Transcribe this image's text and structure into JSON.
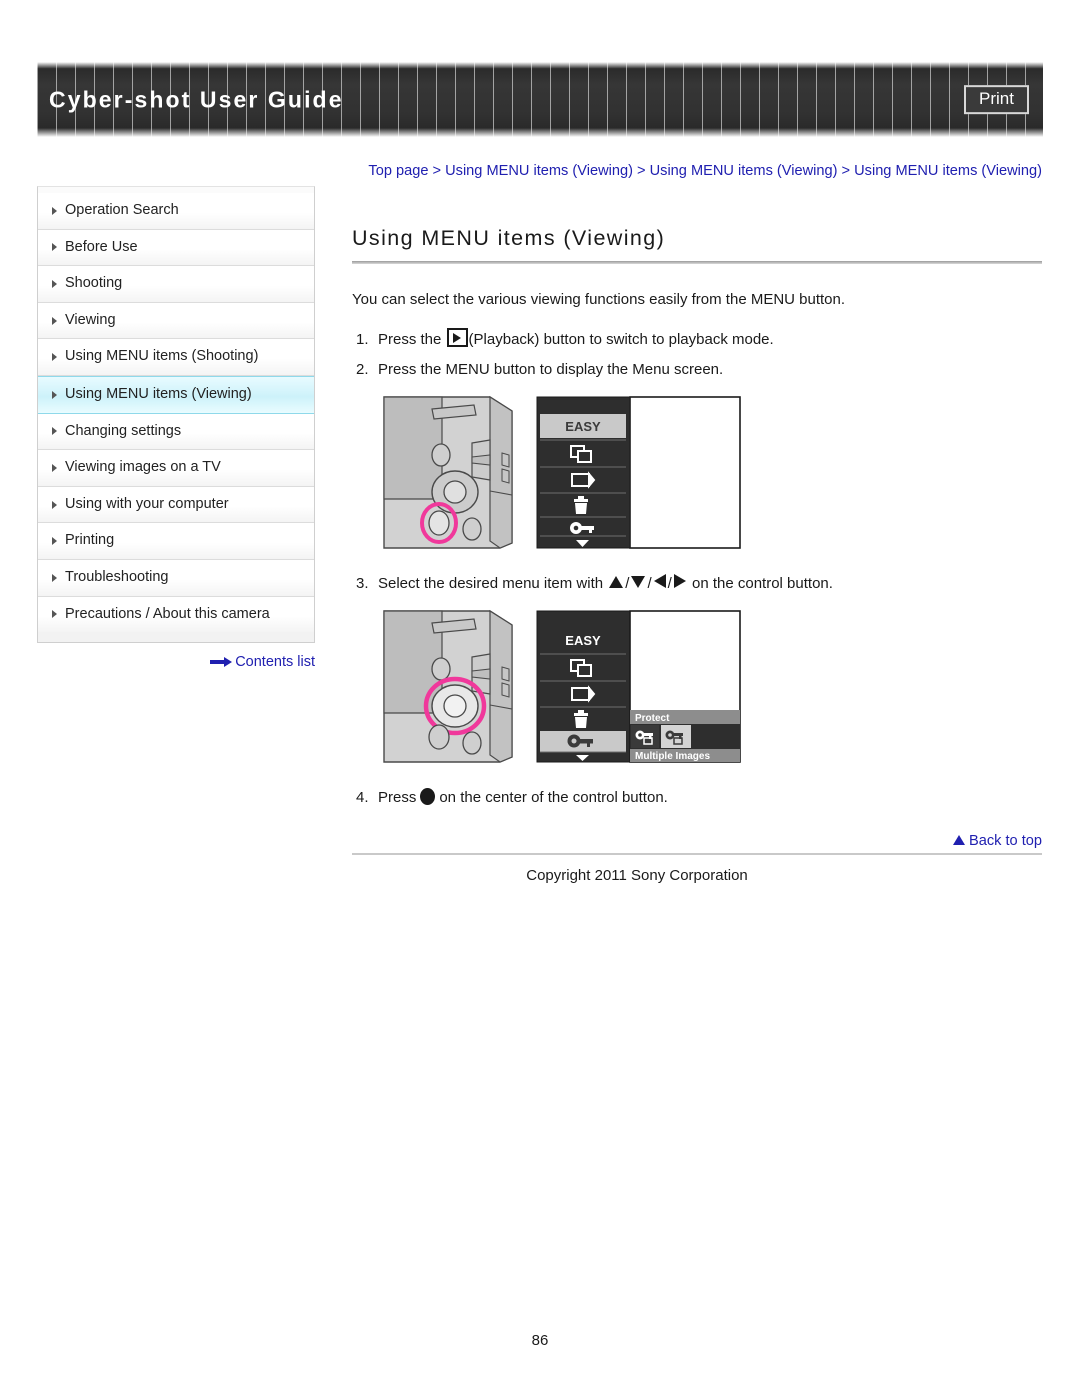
{
  "header": {
    "title": "Cyber-shot User Guide",
    "print_label": "Print"
  },
  "sidebar": {
    "items": [
      {
        "label": "Operation Search",
        "active": false
      },
      {
        "label": "Before Use",
        "active": false
      },
      {
        "label": "Shooting",
        "active": false
      },
      {
        "label": "Viewing",
        "active": false
      },
      {
        "label": "Using MENU items (Shooting)",
        "active": false
      },
      {
        "label": "Using MENU items (Viewing)",
        "active": true
      },
      {
        "label": "Changing settings",
        "active": false
      },
      {
        "label": "Viewing images on a TV",
        "active": false
      },
      {
        "label": "Using with your computer",
        "active": false
      },
      {
        "label": "Printing",
        "active": false
      },
      {
        "label": "Troubleshooting",
        "active": false
      },
      {
        "label": "Precautions / About this camera",
        "active": false
      }
    ],
    "contents_link": "Contents list"
  },
  "main": {
    "breadcrumb": "Top page > Using MENU items (Viewing) > Using MENU items (Viewing) > Using MENU items (Viewing)",
    "title": "Using MENU items (Viewing)",
    "intro": "You can select the various viewing functions easily from the MENU button.",
    "steps": [
      {
        "num": "1.",
        "text_before": "Press the",
        "icon": "playback-icon",
        "text_after": "(Playback) button to switch to playback mode."
      },
      {
        "num": "2.",
        "text_before": "Press the MENU button to display the Menu screen.",
        "icon": "",
        "text_after": ""
      },
      {
        "num": "3.",
        "text_before": "Select the desired menu item with",
        "icon": "direction-pad-icons",
        "text_after": "on the control button."
      },
      {
        "num": "4.",
        "text_before": "Press",
        "icon": "center-dot-icon",
        "text_after": "on the center of the control button."
      }
    ],
    "figure1": {
      "caption_hidden": "Camera rear view with MENU button highlighted and menu screen",
      "highlight_color": "#f0389b",
      "menu_items": [
        {
          "label": "EASY",
          "type": "text",
          "selected": true
        },
        {
          "label": "slideshow-icon",
          "type": "icon",
          "selected": false
        },
        {
          "label": "retouch-icon",
          "type": "icon",
          "selected": false
        },
        {
          "label": "delete-icon",
          "type": "icon",
          "selected": false
        },
        {
          "label": "protect-key-icon",
          "type": "icon",
          "selected": false
        },
        {
          "label": "scroll-down-icon",
          "type": "icon",
          "selected": false
        }
      ]
    },
    "figure2": {
      "caption_hidden": "Camera rear view with control button highlighted and Protect submenu",
      "highlight_color": "#f0389b",
      "menu_items": [
        {
          "label": "EASY",
          "type": "text",
          "selected": false
        },
        {
          "label": "slideshow-icon",
          "type": "icon",
          "selected": false
        },
        {
          "label": "retouch-icon",
          "type": "icon",
          "selected": false
        },
        {
          "label": "delete-icon",
          "type": "icon",
          "selected": false
        },
        {
          "label": "protect-key-icon",
          "type": "icon",
          "selected": true
        },
        {
          "label": "scroll-down-icon",
          "type": "icon",
          "selected": false
        }
      ],
      "submenu_title": "Protect",
      "submenu_footer": "Multiple Images",
      "submenu_options": [
        {
          "label": "protect-off-key-icon",
          "selected": false
        },
        {
          "label": "protect-on-key-icon",
          "selected": true
        }
      ]
    }
  },
  "footer": {
    "back_to_top": "Back to top",
    "copyright": "Copyright 2011 Sony Corporation",
    "page_number": "86"
  }
}
